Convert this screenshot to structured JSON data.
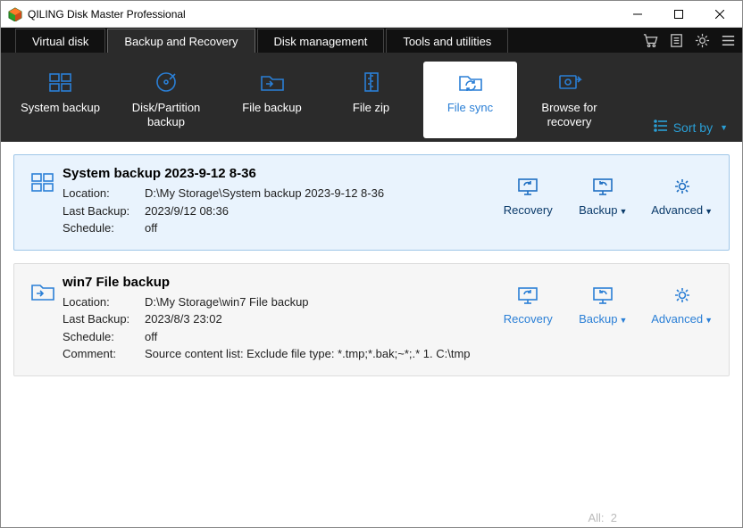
{
  "window": {
    "title": "QILING Disk Master Professional"
  },
  "nav": {
    "tabs": [
      "Virtual disk",
      "Backup and Recovery",
      "Disk management",
      "Tools and utilities"
    ],
    "active": 1
  },
  "toolbar": {
    "items": [
      {
        "label": "System backup"
      },
      {
        "label": "Disk/Partition backup"
      },
      {
        "label": "File backup"
      },
      {
        "label": "File zip"
      },
      {
        "label": "File sync"
      },
      {
        "label": "Browse for recovery"
      }
    ],
    "active": 4,
    "sort_label": "Sort by"
  },
  "tasks": [
    {
      "title": "System backup 2023-9-12 8-36",
      "location_lbl": "Location:",
      "location": "D:\\My Storage\\System backup 2023-9-12 8-36",
      "last_lbl": "Last Backup:",
      "last": "2023/9/12 08:36",
      "sched_lbl": "Schedule:",
      "sched": "off"
    },
    {
      "title": "win7 File backup",
      "location_lbl": "Location:",
      "location": "D:\\My Storage\\win7 File backup",
      "last_lbl": "Last Backup:",
      "last": "2023/8/3 23:02",
      "sched_lbl": "Schedule:",
      "sched": "off",
      "comment_lbl": "Comment:",
      "comment": "Source content list:  Exclude file type: *.tmp;*.bak;~*;.*        1. C:\\tmp"
    }
  ],
  "action_labels": {
    "recovery": "Recovery",
    "backup": "Backup",
    "advanced": "Advanced"
  },
  "status": {
    "all_label": "All:",
    "count": "2"
  }
}
